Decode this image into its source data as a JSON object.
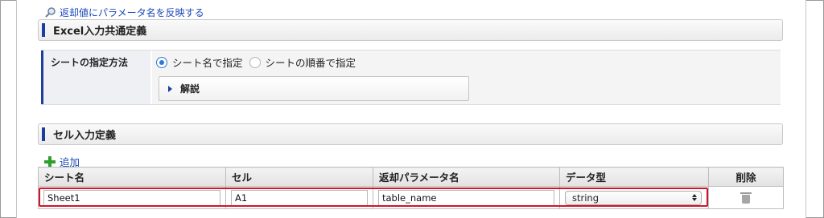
{
  "links": {
    "reflect_param_names": "返却値にパラメータ名を反映する",
    "add": "追加"
  },
  "sections": {
    "excel_common": "Excel入力共通定義",
    "cell_input": "セル入力定義"
  },
  "sheet_spec": {
    "label": "シートの指定方法",
    "options": [
      "シート名で指定",
      "シートの順番で指定"
    ],
    "selected": "シート名で指定",
    "explain_label": "解説"
  },
  "table": {
    "headers": [
      "シート名",
      "セル",
      "返却パラメータ名",
      "データ型",
      "削除"
    ],
    "rows": [
      {
        "sheet": "Sheet1",
        "cell": "A1",
        "param": "table_name",
        "type": "string"
      }
    ]
  },
  "colors": {
    "accent": "#1d3f9b",
    "link": "#1a47b8",
    "highlight": "#d0142c",
    "add": "#2e9e2e"
  }
}
